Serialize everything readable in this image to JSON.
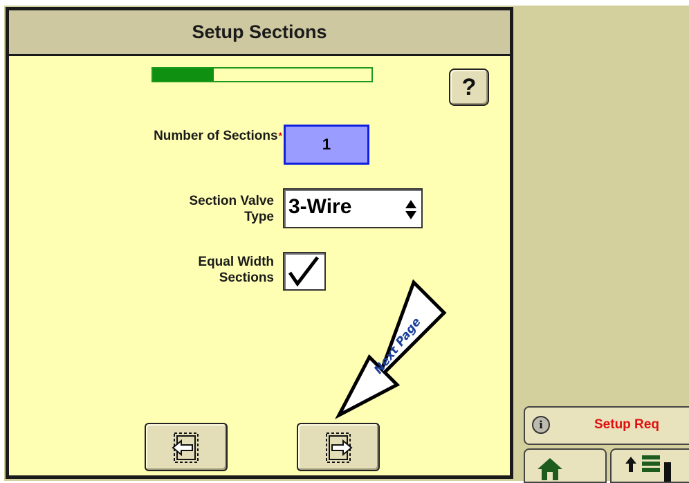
{
  "dialog": {
    "title": "Setup Sections",
    "progress_fraction": 0.28,
    "help_label": "?"
  },
  "form": {
    "number_of_sections": {
      "label": "Number of Sections",
      "required_mark": "*",
      "value": "1"
    },
    "section_valve_type": {
      "label_line1": "Section Valve",
      "label_line2": "Type",
      "value": "3-Wire"
    },
    "equal_width_sections": {
      "label_line1": "Equal Width",
      "label_line2": "Sections",
      "checked": true
    }
  },
  "navigation": {
    "previous_icon": "page-back-icon",
    "next_icon": "page-forward-icon"
  },
  "annotation": {
    "text": "Next Page"
  },
  "status_bar": {
    "status_text": "Setup Req",
    "info_icon": "info-icon",
    "home_icon": "home-icon",
    "layout_icon": "up-arrow-grid-icon"
  },
  "colors": {
    "panel_bg": "#ffffb4",
    "title_bg": "#cdc8a0",
    "progress_green": "#109010",
    "selected_input_bg": "#9b9cff",
    "status_red": "#e01010"
  }
}
